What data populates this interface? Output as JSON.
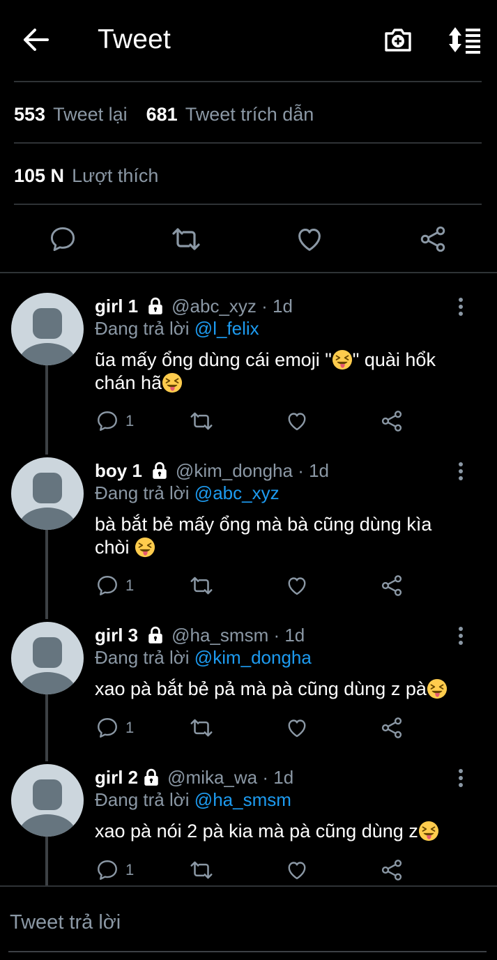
{
  "header": {
    "title": "Tweet",
    "back_icon": "arrow-left-icon",
    "camera_icon": "camera-plus-icon",
    "sort_icon": "sort-list-icon"
  },
  "stats": {
    "retweets_count": "553",
    "retweets_label": "Tweet lại",
    "quotes_count": "681",
    "quotes_label": "Tweet trích dẫn",
    "likes_count": "105 N",
    "likes_label": "Lượt thích"
  },
  "actions": [
    "reply-icon",
    "retweet-icon",
    "like-icon",
    "share-icon"
  ],
  "replies": [
    {
      "name": "girl 1",
      "handle": "@abc_xyz · 1d",
      "replying_label": "Đang trả lời",
      "replying_to": "@l_felix",
      "text_line1": "ũa mấy ổng dùng cái emoji \"",
      "text_line1_after": "\" quài hổk",
      "text_line2": "chán hã",
      "reply_count": "1"
    },
    {
      "name": "boy 1",
      "handle": "@kim_dongha · 1d",
      "replying_label": "Đang trả lời",
      "replying_to": "@abc_xyz",
      "text_line1": "bà bắt bẻ mấy ổng mà bà cũng dùng kìa",
      "text_line2": "chòi ",
      "reply_count": "1"
    },
    {
      "name": "girl 3",
      "handle": "@ha_smsm · 1d",
      "replying_label": "Đang trả lời",
      "replying_to": "@kim_dongha",
      "text_line1": "xao pà bắt bẻ pả mà pà cũng dùng z pà",
      "reply_count": "1"
    },
    {
      "name": "girl 2",
      "handle": "@mika_wa · 1d",
      "replying_label": "Đang trả lời",
      "replying_to": "@ha_smsm",
      "text_line1": "xao pà nói 2 pà kia mà pà cũng dùng z",
      "reply_count": "1"
    }
  ],
  "compose": {
    "placeholder": "Tweet trả lời"
  },
  "colors": {
    "background": "#000000",
    "secondary_text": "#8b98a5",
    "mention": "#1d9bf0",
    "divider": "#2f3336"
  }
}
